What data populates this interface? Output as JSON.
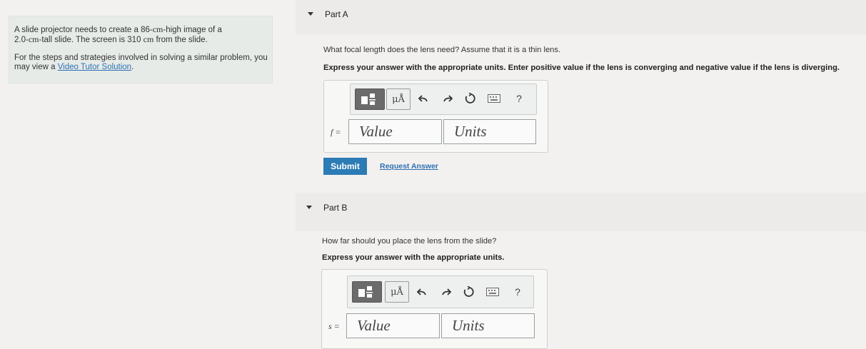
{
  "problem": {
    "line1": "A slide projector needs to create a 86-",
    "unit_cm": "cm",
    "line1_end": "-high image of a",
    "line2_start": "2.0-",
    "line2_mid": "-tall slide. The screen is 310 ",
    "line2_end": " from the slide.",
    "help_text": "For the steps and strategies involved in solving a similar problem, you may view a ",
    "help_link": "Video Tutor Solution",
    "help_end": "."
  },
  "part_a": {
    "title": "Part A",
    "question": "What focal length does the lens need? Assume that it is a thin lens.",
    "instruction": "Express your answer with the appropriate units. Enter positive value if the lens is converging and negative value if the lens is diverging.",
    "var_label": "f =",
    "value_placeholder": "Value",
    "units_placeholder": "Units",
    "toolbar": {
      "units_label": "μÅ",
      "help_label": "?"
    },
    "submit_label": "Submit",
    "request_label": "Request Answer"
  },
  "part_b": {
    "title": "Part B",
    "question": "How far should you place the lens from the slide?",
    "instruction": "Express your answer with the appropriate units.",
    "var_label": "s =",
    "value_placeholder": "Value",
    "units_placeholder": "Units",
    "toolbar": {
      "units_label": "μÅ",
      "help_label": "?"
    }
  }
}
